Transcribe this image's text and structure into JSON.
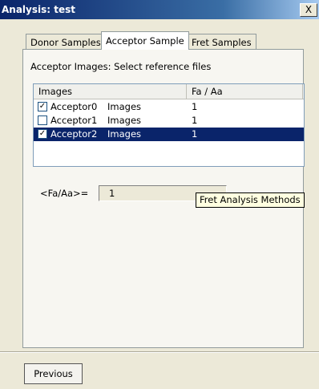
{
  "window": {
    "title": "Analysis: test",
    "close_glyph": "X"
  },
  "tabs": [
    {
      "label": "Donor Samples",
      "active": false
    },
    {
      "label": "Acceptor Sample",
      "active": true
    },
    {
      "label": "Fret Samples",
      "active": false
    }
  ],
  "panel": {
    "heading": "Acceptor Images: Select reference files"
  },
  "listview": {
    "columns": [
      "Images",
      "Fa / Aa"
    ],
    "rows": [
      {
        "checked": true,
        "name": "Acceptor0",
        "type": "Images",
        "value": "1",
        "selected": false
      },
      {
        "checked": false,
        "name": "Acceptor1",
        "type": "Images",
        "value": "1",
        "selected": false
      },
      {
        "checked": true,
        "name": "Acceptor2",
        "type": "Images",
        "value": "1",
        "selected": true
      }
    ]
  },
  "ratio": {
    "label": "<Fa/Aa>=",
    "value": "1"
  },
  "tooltip": {
    "text": "Fret Analysis Methods"
  },
  "footer": {
    "previous_label": "Previous"
  },
  "colors": {
    "titlebar_start": "#0a246a",
    "selection": "#0a246a",
    "tooltip_bg": "#ffffe1",
    "dialog_bg": "#ece9d8"
  }
}
